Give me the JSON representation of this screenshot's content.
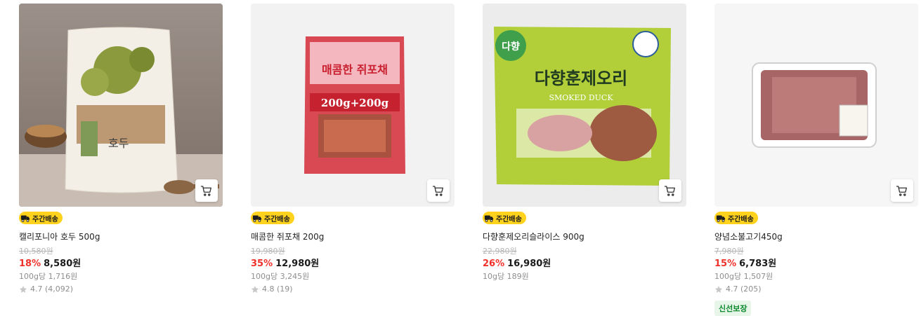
{
  "products": [
    {
      "name": "캘리포니아 호두 500g",
      "badge": "주간배송",
      "original_price": "10,580원",
      "discount": "18%",
      "price": "8,580원",
      "unit_price": "100g당 1,716원",
      "rating": "4.7 (4,092)",
      "image_text": "호두",
      "cart_icon": "cart-icon"
    },
    {
      "name": "매콤한 쥐포채 200g",
      "badge": "주간배송",
      "original_price": "19,980원",
      "discount": "35%",
      "price": "12,980원",
      "unit_price": "100g당 3,245원",
      "rating": "4.8 (19)",
      "image_text": "매콤한 쥐포채",
      "image_sub": "200g+200g",
      "cart_icon": "cart-icon"
    },
    {
      "name": "다향훈제오리슬라이스 900g",
      "badge": "주간배송",
      "original_price": "22,980원",
      "discount": "26%",
      "price": "16,980원",
      "unit_price": "10g당 189원",
      "rating": "",
      "image_text": "다향훈제오리",
      "image_sub": "SMOKED DUCK",
      "image_brand": "다향",
      "cart_icon": "cart-icon"
    },
    {
      "name": "양념소불고기450g",
      "badge": "주간배송",
      "original_price": "7,980원",
      "discount": "15%",
      "price": "6,783원",
      "unit_price": "100g당 1,507원",
      "rating": "4.7 (205)",
      "fresh_badge": "신선보장",
      "cart_icon": "cart-icon"
    }
  ],
  "colors": {
    "discount": "#f0312b",
    "badge_bg": "#ffd21e",
    "fresh_green": "#0c8a2d"
  }
}
